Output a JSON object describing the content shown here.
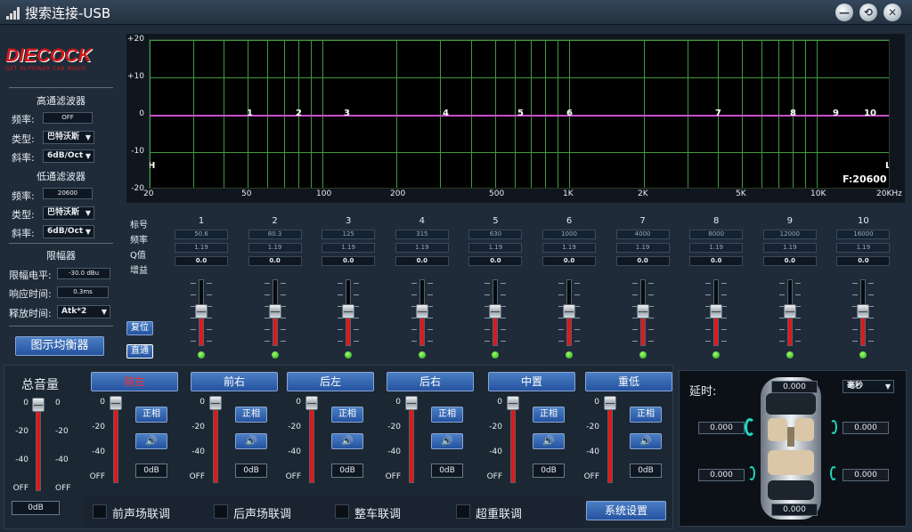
{
  "window": {
    "title": "搜索连接-USB",
    "buttons": [
      "—",
      "⟲",
      "✕"
    ]
  },
  "brand": {
    "logo": "DIECOCK",
    "tagline": "GET HI-POWER CAR MUSIC"
  },
  "highpass": {
    "heading": "高通滤波器",
    "freq_label": "频率:",
    "freq": "OFF",
    "type_label": "类型:",
    "type": "巴特沃斯",
    "slope_label": "斜率:",
    "slope": "6dB/Oct"
  },
  "lowpass": {
    "heading": "低通滤波器",
    "freq_label": "频率:",
    "freq": "20600",
    "type_label": "类型:",
    "type": "巴特沃斯",
    "slope_label": "斜率:",
    "slope": "6dB/Oct"
  },
  "limiter": {
    "heading": "限幅器",
    "level_label": "限幅电平:",
    "level": "-30.0 dBu",
    "attack_label": "响应时间:",
    "attack": "0.3ms",
    "release_label": "释放时间:",
    "release": "Atk*2"
  },
  "graphic_eq_button": "图示均衡器",
  "graph": {
    "y_ticks": [
      "+20",
      "+10",
      "0",
      "-10",
      "-20"
    ],
    "x_ticks": [
      "20",
      "50",
      "100",
      "200",
      "500",
      "1K",
      "2K",
      "5K",
      "10K",
      "20KHz"
    ],
    "h_marker": "H",
    "l_marker": "L",
    "freq_readout": "F:20600",
    "points": [
      "1",
      "2",
      "3",
      "4",
      "5",
      "6",
      "7",
      "8",
      "9",
      "10"
    ]
  },
  "eq": {
    "row_labels": {
      "index": "标号",
      "freq": "频率",
      "q": "Q值",
      "gain": "增益"
    },
    "reset": "复位",
    "pass": "直通",
    "channels": [
      {
        "index": "1",
        "freq": "50.6",
        "q": "1.19",
        "gain": "0.0"
      },
      {
        "index": "2",
        "freq": "80.3",
        "q": "1.19",
        "gain": "0.0"
      },
      {
        "index": "3",
        "freq": "125",
        "q": "1.19",
        "gain": "0.0"
      },
      {
        "index": "4",
        "freq": "315",
        "q": "1.19",
        "gain": "0.0"
      },
      {
        "index": "5",
        "freq": "630",
        "q": "1.19",
        "gain": "0.0"
      },
      {
        "index": "6",
        "freq": "1000",
        "q": "1.19",
        "gain": "0.0"
      },
      {
        "index": "7",
        "freq": "4000",
        "q": "1.19",
        "gain": "0.0"
      },
      {
        "index": "8",
        "freq": "8000",
        "q": "1.19",
        "gain": "0.0"
      },
      {
        "index": "9",
        "freq": "12000",
        "q": "1.19",
        "gain": "0.0"
      },
      {
        "index": "10",
        "freq": "16000",
        "q": "1.19",
        "gain": "0.0"
      }
    ]
  },
  "master": {
    "label": "总音量",
    "value": "0dB",
    "scale": [
      "0",
      "-20",
      "-40",
      "OFF"
    ]
  },
  "outputs": {
    "scale": [
      "0",
      "-20",
      "-40",
      "OFF"
    ],
    "phase_label": "正相",
    "speaker_icon": "🔊",
    "channels": [
      {
        "name": "前左",
        "value": "0dB"
      },
      {
        "name": "前右",
        "value": "0dB"
      },
      {
        "name": "后左",
        "value": "0dB"
      },
      {
        "name": "后右",
        "value": "0dB"
      },
      {
        "name": "中置",
        "value": "0dB"
      },
      {
        "name": "重低",
        "value": "0dB"
      }
    ]
  },
  "links": [
    "前声场联调",
    "后声场联调",
    "整车联调",
    "超重联调"
  ],
  "settings_button": "系统设置",
  "delay": {
    "label": "延时:",
    "unit": "毫秒",
    "top": "0.000",
    "front_left": "0.000",
    "front_right": "0.000",
    "rear_left": "0.000",
    "rear_right": "0.000",
    "bottom": "0.000"
  },
  "colors": {
    "accent_blue": "#2f63b0",
    "curve": "#c850c8",
    "grid": "#3f9a3f",
    "fader_red": "#e01818",
    "led_green": "#2fd02a"
  }
}
